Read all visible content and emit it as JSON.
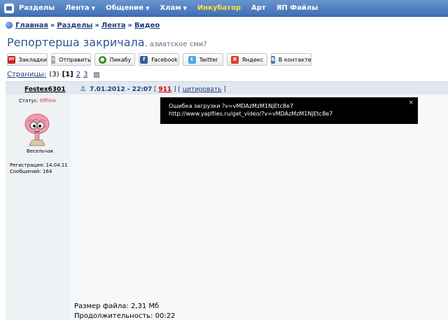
{
  "nav": {
    "items": [
      {
        "label": "Разделы",
        "caret": false,
        "highlight": false
      },
      {
        "label": "Лента",
        "caret": true,
        "highlight": false
      },
      {
        "label": "Общение",
        "caret": true,
        "highlight": false
      },
      {
        "label": "Хлам",
        "caret": true,
        "highlight": false
      },
      {
        "label": "Инкубатор",
        "caret": false,
        "highlight": true
      },
      {
        "label": "Арт",
        "caret": false,
        "highlight": false
      },
      {
        "label": "ЯП Файлы",
        "caret": false,
        "highlight": false
      }
    ]
  },
  "breadcrumb": {
    "items": [
      "Главная",
      "Разделы",
      "Лента",
      "Видео"
    ],
    "separator": "»"
  },
  "topic": {
    "title": "Репортерша закричала",
    "subtitle": ", азиатское сми?"
  },
  "share": {
    "buttons": [
      {
        "label": "Закладки",
        "icon": "bookmarks-icon",
        "color": "#cc2222",
        "glyph": "ЯП"
      },
      {
        "label": "Отправить",
        "icon": "mail-icon",
        "color": "#9aa4b0",
        "glyph": "✉"
      },
      {
        "label": "Пикабу",
        "icon": "pikabu-icon",
        "color": "#3d8c2f",
        "glyph": "●"
      },
      {
        "label": "Facebook",
        "icon": "facebook-icon",
        "color": "#3b5998",
        "glyph": "f"
      },
      {
        "label": "Twitter",
        "icon": "twitter-icon",
        "color": "#4aa8e0",
        "glyph": "t"
      },
      {
        "label": "Яндекс",
        "icon": "yandex-icon",
        "color": "#e03a2a",
        "glyph": "Я"
      },
      {
        "label": "В контакте",
        "icon": "vkontakte-icon",
        "color": "#4a76a8",
        "glyph": "В"
      }
    ]
  },
  "pagination": {
    "label": "Страницы:",
    "count": "(3)",
    "current": "[1]",
    "pages": [
      "2",
      "3"
    ]
  },
  "post": {
    "author": "Fostex6301",
    "date": "7.01.2012 - 22:07",
    "number": "911",
    "quote": "цитировать",
    "status_label": "Статус:",
    "status_value": "Offline",
    "rank": "Весельчак",
    "registration": "Регистрация: 14.04.11",
    "messages": "Сообщений: 164"
  },
  "error": {
    "line1": "Ошибка загрузки ?v=vMDAzMzM1NjEtc8e7",
    "line2": "http://www.yapfiles.ru/get_video/?v=vMDAzMzM1NjEtc8e7",
    "close": "×"
  },
  "file": {
    "size": "Размер файла: 2,31 Мб",
    "duration": "Продолжительность: 00:22"
  },
  "colors": {
    "nav_bg": "#4a7cc0",
    "nav_highlight": "#ffe433",
    "link": "#1e3e7e",
    "title": "#2a5891",
    "offline": "#e03030",
    "post_number": "#d00000"
  }
}
